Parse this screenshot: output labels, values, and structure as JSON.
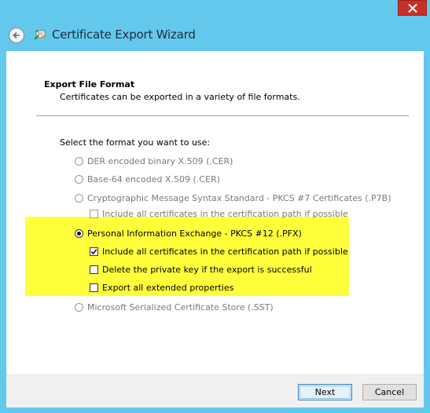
{
  "window": {
    "title": "Certificate Export Wizard",
    "accent": "#64c8ec",
    "close_color": "#c7312a"
  },
  "icons": {
    "back": "back-arrow-icon",
    "wizard": "certificate-icon",
    "close": "close-icon"
  },
  "page": {
    "heading": "Export File Format",
    "description": "Certificates can be exported in a variety of file formats.",
    "prompt": "Select the format you want to use:"
  },
  "options": {
    "der": {
      "label": "DER encoded binary X.509 (.CER)",
      "selected": false,
      "enabled": false
    },
    "base64": {
      "label": "Base-64 encoded X.509 (.CER)",
      "selected": false,
      "enabled": false
    },
    "pkcs7": {
      "label": "Cryptographic Message Syntax Standard - PKCS #7 Certificates (.P7B)",
      "selected": false,
      "enabled": false
    },
    "pkcs7_include": {
      "label": "Include all certificates in the certification path if possible",
      "checked": false,
      "enabled": false
    },
    "pfx": {
      "label": "Personal Information Exchange - PKCS #12 (.PFX)",
      "selected": true,
      "enabled": true
    },
    "pfx_include": {
      "label": "Include all certificates in the certification path if possible",
      "checked": true,
      "enabled": true
    },
    "pfx_delete_key": {
      "label": "Delete the private key if the export is successful",
      "checked": false,
      "enabled": true
    },
    "pfx_export_ext": {
      "label": "Export all extended properties",
      "checked": false,
      "enabled": true
    },
    "sst": {
      "label": "Microsoft Serialized Certificate Store (.SST)",
      "selected": false,
      "enabled": false
    }
  },
  "highlight_color": "#ffff3c",
  "buttons": {
    "next": "Next",
    "cancel": "Cancel"
  }
}
